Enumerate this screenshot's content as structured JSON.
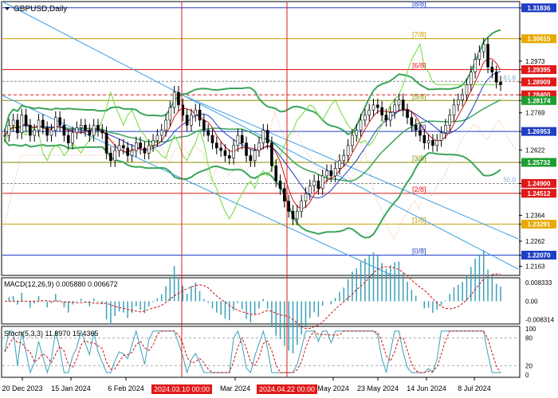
{
  "chart_data": {
    "type": "line",
    "symbol_title": "GBPUSD,Daily",
    "price_axis": {
      "range": [
        1.213,
        1.3205
      ],
      "ticks": [
        "1.3183",
        "1.3061",
        "1.2973",
        "1.2939",
        "1.2890",
        "1.2840",
        "1.2817",
        "1.2769",
        "1.2695",
        "1.2622",
        "1.2573",
        "1.2490",
        "1.2451",
        "1.2364",
        "1.2329",
        "1.2262",
        "1.2207",
        "1.2163"
      ]
    },
    "date_axis": {
      "labels": [
        "20 Dec 2023",
        "15 Jan 2024",
        "6 Feb 2024",
        "Mar 2024",
        "May 2024",
        "23 May 2024",
        "14 Jun 2024",
        "8 Jul 2024"
      ],
      "highlighted": [
        "2024.03.10 00:00",
        "2024.04.22 00:00"
      ]
    },
    "price_labels": [
      {
        "value": "1.31836",
        "price": 1.31836,
        "color": "#1f3fc4"
      },
      {
        "value": "1.30615",
        "price": 1.30615,
        "color": "#e8a900"
      },
      {
        "value": "1.29395",
        "price": 1.29395,
        "color": "#e01818"
      },
      {
        "value": "1.28909",
        "price": 1.28909,
        "color": "#e01818"
      },
      {
        "value": "1.28400",
        "price": 1.284,
        "color": "#e01818"
      },
      {
        "value": "1.28174",
        "price": 1.28174,
        "color": "#1e9e32"
      },
      {
        "value": "1.26953",
        "price": 1.26953,
        "color": "#1f3fc4"
      },
      {
        "value": "1.25732",
        "price": 1.25732,
        "color": "#1e9e32"
      },
      {
        "value": "1.24900",
        "price": 1.249,
        "color": "#e01818"
      },
      {
        "value": "1.24512",
        "price": 1.24512,
        "color": "#e01818"
      },
      {
        "value": "1.23291",
        "price": 1.23291,
        "color": "#e8a900"
      },
      {
        "value": "1.22070",
        "price": 1.2207,
        "color": "#1f3fc4"
      }
    ],
    "murrey_levels": [
      {
        "label": "[8/8]",
        "price": 1.31836,
        "color": "#1f3fc4"
      },
      {
        "label": "[7/8]",
        "price": 1.30615,
        "color": "#c8a000"
      },
      {
        "label": "[6/8]",
        "price": 1.29395,
        "color": "#e01818"
      },
      {
        "label": "[5/8]",
        "price": 1.28174,
        "color": "#8a8a00"
      },
      {
        "label": "[4/8]",
        "price": 1.26953,
        "color": "#1f3fc4"
      },
      {
        "label": "[3/8]",
        "price": 1.25732,
        "color": "#8a8a00"
      },
      {
        "label": "[2/8]",
        "price": 1.24512,
        "color": "#e01818"
      },
      {
        "label": "[1/8]",
        "price": 1.23291,
        "color": "#c8a000"
      },
      {
        "label": "[0/8]",
        "price": 1.2207,
        "color": "#1f3fc4"
      }
    ],
    "fib_labels": [
      {
        "label": "61.8",
        "price": 1.2893
      },
      {
        "label": "50.0",
        "price": 1.249
      }
    ],
    "close_series": [
      1.268,
      1.272,
      1.274,
      1.269,
      1.276,
      1.272,
      1.268,
      1.27,
      1.274,
      1.271,
      1.268,
      1.27,
      1.275,
      1.272,
      1.268,
      1.265,
      1.269,
      1.271,
      1.272,
      1.27,
      1.268,
      1.272,
      1.27,
      1.269,
      1.261,
      1.258,
      1.262,
      1.264,
      1.263,
      1.26,
      1.262,
      1.265,
      1.263,
      1.261,
      1.264,
      1.266,
      1.268,
      1.27,
      1.274,
      1.279,
      1.285,
      1.28,
      1.276,
      1.272,
      1.276,
      1.278,
      1.274,
      1.27,
      1.268,
      1.265,
      1.263,
      1.262,
      1.26,
      1.259,
      1.264,
      1.268,
      1.265,
      1.26,
      1.258,
      1.262,
      1.265,
      1.27,
      1.265,
      1.256,
      1.25,
      1.247,
      1.242,
      1.238,
      1.235,
      1.238,
      1.242,
      1.245,
      1.248,
      1.25,
      1.247,
      1.252,
      1.254,
      1.252,
      1.255,
      1.258,
      1.26,
      1.264,
      1.268,
      1.27,
      1.274,
      1.276,
      1.278,
      1.28,
      1.279,
      1.276,
      1.274,
      1.277,
      1.28,
      1.282,
      1.278,
      1.275,
      1.272,
      1.27,
      1.268,
      1.265,
      1.266,
      1.264,
      1.266,
      1.269,
      1.272,
      1.276,
      1.28,
      1.282,
      1.284,
      1.288,
      1.293,
      1.298,
      1.301,
      1.304,
      1.295,
      1.293,
      1.289,
      1.288
    ],
    "indicators": {
      "macd": {
        "label": "MACD(12,26,9) 0.005880 0.006672",
        "ticks": [
          "0.008333",
          "0.00",
          "-0.008314"
        ],
        "range": [
          -0.0092,
          0.0095
        ]
      },
      "stoch": {
        "label": "Stoch(5,3,3) 11.8970 15.4365",
        "ticks": [
          "100",
          "80",
          "20",
          "0"
        ],
        "range": [
          0,
          100
        ]
      }
    }
  }
}
